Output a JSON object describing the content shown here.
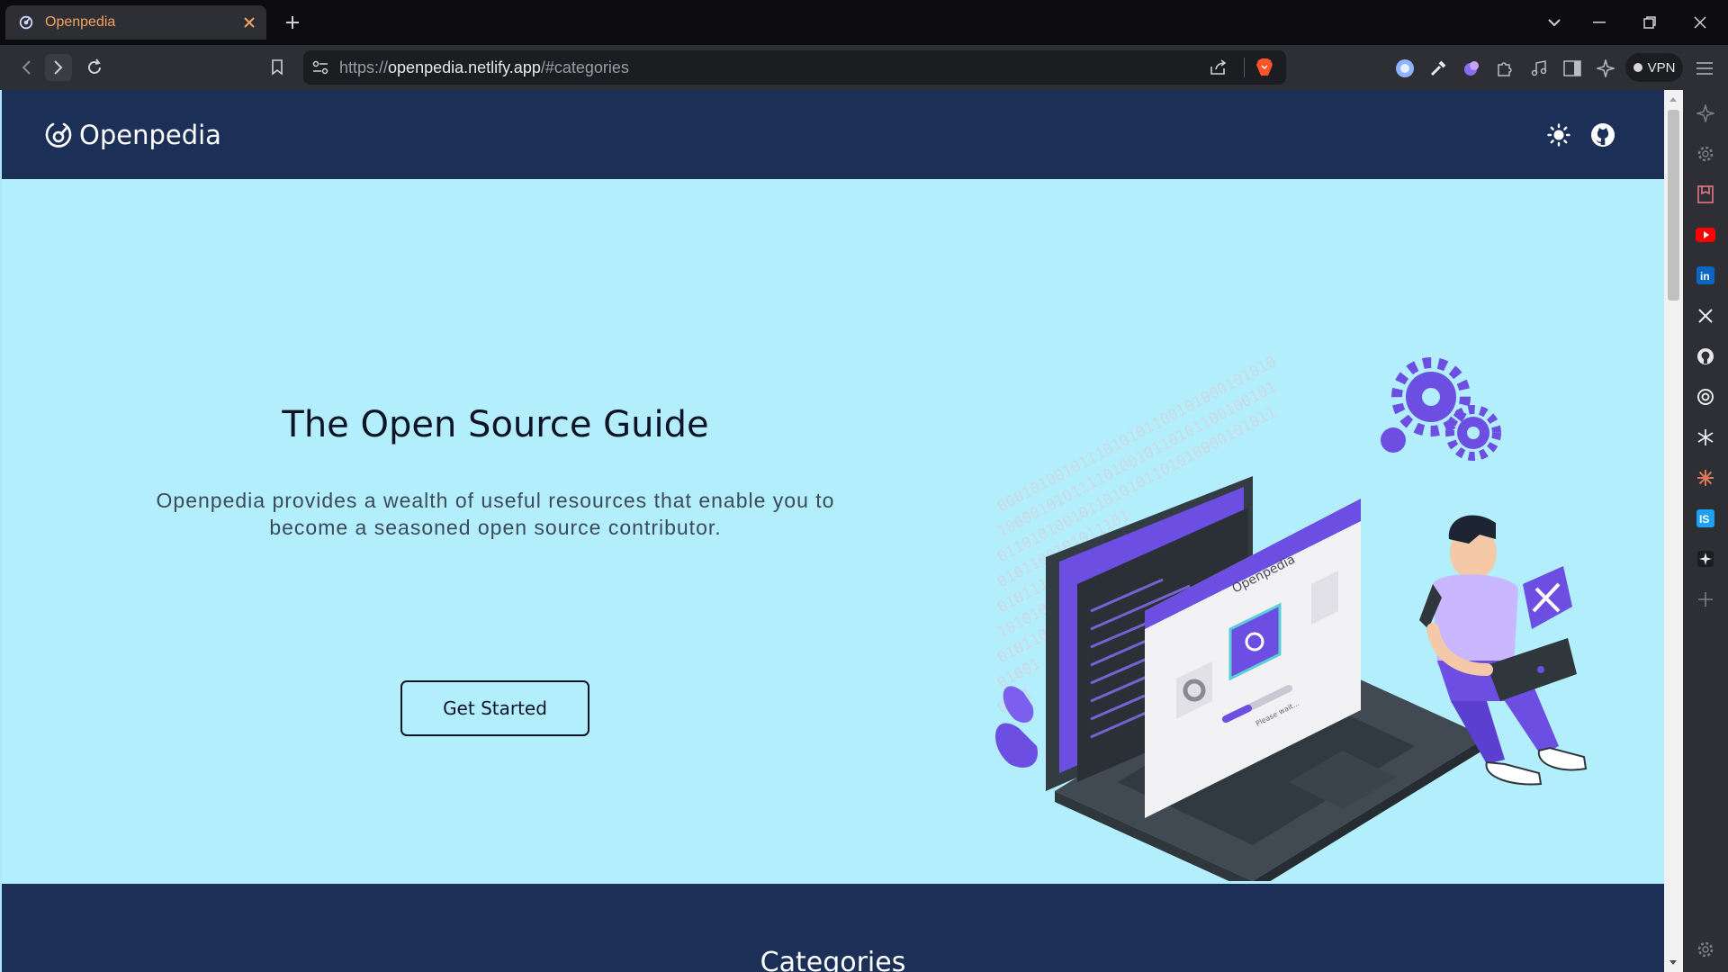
{
  "browser": {
    "tab_title": "Openpedia",
    "url_prefix": "https://",
    "url_host": "openpedia.netlify.app",
    "url_path": "/#categories",
    "vpn_label": "VPN"
  },
  "site": {
    "logo_text": "Openpedia",
    "hero": {
      "title": "The Open Source Guide",
      "description": "Openpedia provides a wealth of useful resources that enable you to become a seasoned open source contributor.",
      "cta_label": "Get Started"
    },
    "illustration": {
      "card_label": "Openpedia",
      "progress_label": "Please wait..."
    },
    "categories_title": "Categories"
  },
  "colors": {
    "header_bg": "#1b2f57",
    "hero_bg": "#b2eefb",
    "accent_purple": "#6c4ee3",
    "tab_title": "#f5a25d"
  },
  "icons": {
    "theme_toggle": "sun-icon",
    "repo_link": "github-icon"
  }
}
